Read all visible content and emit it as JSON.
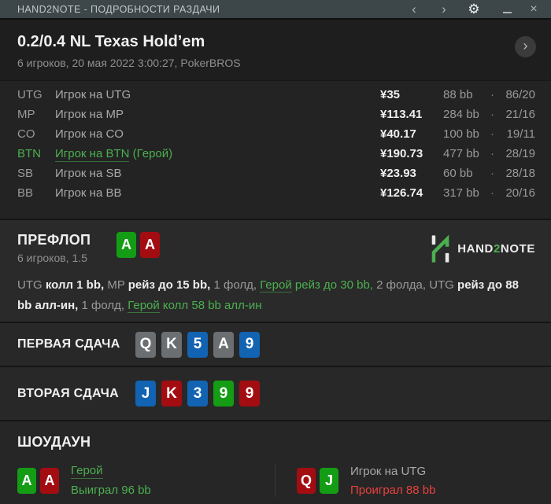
{
  "titlebar": {
    "title": "HAND2NOTE - ПОДРОБНОСТИ РАЗДАЧИ",
    "icons": {
      "back": "‹",
      "forward": "›",
      "gear": "⚙",
      "close": "×"
    }
  },
  "hand_header": {
    "title": "0.2/0.4 NL Texas Hold’em",
    "subtitle": "6 игроков, 20 мая 2022 3:00:27, PokerBROS",
    "next_icon": "›"
  },
  "players": {
    "rows": [
      {
        "pos": "UTG",
        "name": "Игрок на UTG",
        "suffix": "",
        "hero": false,
        "amount": "¥35",
        "bb": "88 bb",
        "dot": "·",
        "stats": "86/20"
      },
      {
        "pos": "MP",
        "name": "Игрок на MP",
        "suffix": "",
        "hero": false,
        "amount": "¥113.41",
        "bb": "284 bb",
        "dot": "·",
        "stats": "21/16"
      },
      {
        "pos": "CO",
        "name": "Игрок на CO",
        "suffix": "",
        "hero": false,
        "amount": "¥40.17",
        "bb": "100 bb",
        "dot": "·",
        "stats": "19/11"
      },
      {
        "pos": "BTN",
        "name": "Игрок на BTN",
        "suffix": " (Герой)",
        "hero": true,
        "amount": "¥190.73",
        "bb": "477 bb",
        "dot": "·",
        "stats": "28/19"
      },
      {
        "pos": "SB",
        "name": "Игрок на SB",
        "suffix": "",
        "hero": false,
        "amount": "¥23.93",
        "bb": "60 bb",
        "dot": "·",
        "stats": "28/18"
      },
      {
        "pos": "BB",
        "name": "Игрок на BB",
        "suffix": "",
        "hero": false,
        "amount": "¥126.74",
        "bb": "317 bb",
        "dot": "·",
        "stats": "20/16"
      }
    ]
  },
  "preflop": {
    "label": "ПРЕФЛОП",
    "subtitle": "6 игроков, 1.5",
    "hero_cards": [
      {
        "rank": "A",
        "color": "green"
      },
      {
        "rank": "A",
        "color": "red"
      }
    ],
    "logo": {
      "part1": "HAND",
      "part2": "2",
      "part3": "NOTE"
    },
    "action_segments": [
      {
        "text": "UTG ",
        "style": "gray"
      },
      {
        "text": "колл 1 bb, ",
        "style": "white"
      },
      {
        "text": "MP ",
        "style": "gray"
      },
      {
        "text": "рейз до 15 bb, ",
        "style": "white"
      },
      {
        "text": "1 фолд, ",
        "style": "gray"
      },
      {
        "text": "Герой",
        "style": "green-link"
      },
      {
        "text": " рейз до 30 bb, ",
        "style": "green"
      },
      {
        "text": "2 фолда, ",
        "style": "gray"
      },
      {
        "text": "UTG ",
        "style": "gray"
      },
      {
        "text": "рейз до 88 bb алл-ин, ",
        "style": "white"
      },
      {
        "text": "1 фолд, ",
        "style": "gray"
      },
      {
        "text": "Герой",
        "style": "green-link"
      },
      {
        "text": " колл 58 bb алл-ин",
        "style": "green"
      }
    ]
  },
  "boards": [
    {
      "label": "ПЕРВАЯ СДАЧА",
      "cards": [
        {
          "rank": "Q",
          "color": "gray"
        },
        {
          "rank": "K",
          "color": "gray"
        },
        {
          "rank": "5",
          "color": "blue"
        },
        {
          "rank": "A",
          "color": "gray"
        },
        {
          "rank": "9",
          "color": "blue"
        }
      ]
    },
    {
      "label": "ВТОРАЯ СДАЧА",
      "cards": [
        {
          "rank": "J",
          "color": "blue"
        },
        {
          "rank": "K",
          "color": "red"
        },
        {
          "rank": "3",
          "color": "blue"
        },
        {
          "rank": "9",
          "color": "green"
        },
        {
          "rank": "9",
          "color": "red"
        }
      ]
    }
  ],
  "showdown": {
    "label": "ШОУДАУН",
    "players": [
      {
        "cards": [
          {
            "rank": "A",
            "color": "green"
          },
          {
            "rank": "A",
            "color": "red"
          }
        ],
        "name": "Герой",
        "hero": true,
        "result": "Выиграл 96 bb",
        "result_type": "win"
      },
      {
        "cards": [
          {
            "rank": "Q",
            "color": "red"
          },
          {
            "rank": "J",
            "color": "green"
          }
        ],
        "name": "Игрок на UTG",
        "hero": false,
        "result": "Проиграл 88 bb",
        "result_type": "loss"
      }
    ]
  },
  "colors": {
    "accent_green": "#4caf50",
    "loss_red": "#e8413c",
    "card_green": "#149c14",
    "card_red": "#a30d12",
    "card_blue": "#1263b2",
    "card_gray": "#6b6f72",
    "titlebar_bg": "#3d4649"
  }
}
